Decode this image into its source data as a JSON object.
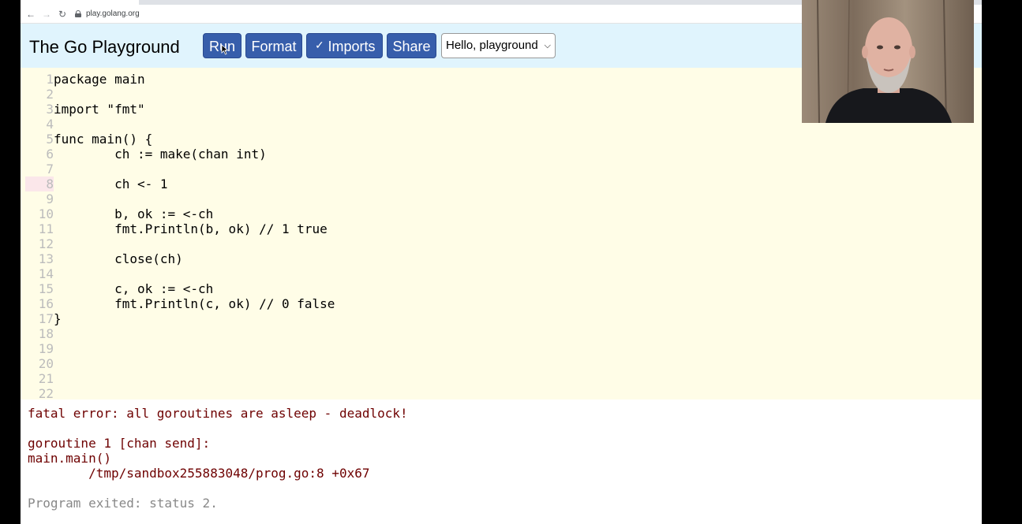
{
  "browser": {
    "url": "play.golang.org",
    "nav": {
      "back": "←",
      "forward": "→",
      "reload": "↻"
    }
  },
  "header": {
    "title": "The Go Playground",
    "run_label": "Run",
    "format_label": "Format",
    "imports_label": "Imports",
    "imports_checked": true,
    "share_label": "Share",
    "examples_selected": "Hello, playground"
  },
  "editor": {
    "highlight_line": 8,
    "lines": [
      {
        "n": "1",
        "code": "package main"
      },
      {
        "n": "2",
        "code": ""
      },
      {
        "n": "3",
        "code": "import \"fmt\""
      },
      {
        "n": "4",
        "code": ""
      },
      {
        "n": "5",
        "code": "func main() {"
      },
      {
        "n": "6",
        "code": "        ch := make(chan int)"
      },
      {
        "n": "7",
        "code": ""
      },
      {
        "n": "8",
        "code": "        ch <- 1"
      },
      {
        "n": "9",
        "code": ""
      },
      {
        "n": "10",
        "code": "        b, ok := <-ch"
      },
      {
        "n": "11",
        "code": "        fmt.Println(b, ok) // 1 true"
      },
      {
        "n": "12",
        "code": ""
      },
      {
        "n": "13",
        "code": "        close(ch)"
      },
      {
        "n": "14",
        "code": ""
      },
      {
        "n": "15",
        "code": "        c, ok := <-ch"
      },
      {
        "n": "16",
        "code": "        fmt.Println(c, ok) // 0 false"
      },
      {
        "n": "17",
        "code": "}"
      },
      {
        "n": "18",
        "code": ""
      },
      {
        "n": "19",
        "code": ""
      },
      {
        "n": "20",
        "code": ""
      },
      {
        "n": "21",
        "code": ""
      },
      {
        "n": "22",
        "code": ""
      }
    ]
  },
  "output": {
    "lines": [
      "fatal error: all goroutines are asleep - deadlock!",
      "",
      "goroutine 1 [chan send]:",
      "main.main()",
      "        /tmp/sandbox255883048/prog.go:8 +0x67",
      ""
    ],
    "exit_status": "Program exited: status 2."
  },
  "colors": {
    "button_bg": "#375eab",
    "topbar_bg": "#e0f4fd",
    "editor_bg": "#fffde7",
    "error_text": "#6e0000"
  }
}
